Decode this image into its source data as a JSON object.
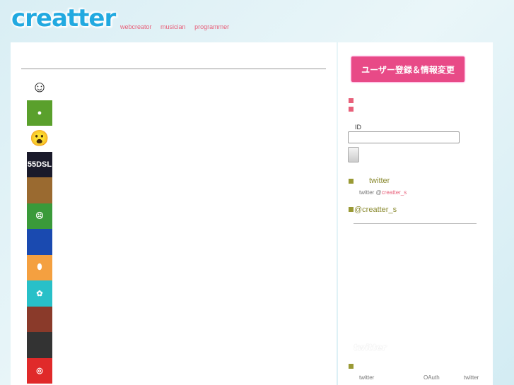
{
  "header": {
    "logo": "creatter",
    "tags": [
      "webcreator",
      "musician",
      "programmer"
    ]
  },
  "main": {
    "avatars": [
      {
        "name": "sketch-face",
        "color": "#ffffff",
        "glyph": "☺"
      },
      {
        "name": "bomberman",
        "color": "#5aa02c",
        "glyph": "●"
      },
      {
        "name": "laughing-cartoon",
        "color": "#ffffff",
        "glyph": "😮"
      },
      {
        "name": "55dsl",
        "color": "#1a1a2a",
        "glyph": "55DSL"
      },
      {
        "name": "teddy-bear",
        "color": "#9a6a30",
        "glyph": ""
      },
      {
        "name": "mii-face",
        "color": "#3a9a3a",
        "glyph": "☹"
      },
      {
        "name": "underwater",
        "color": "#1a4ab0",
        "glyph": ""
      },
      {
        "name": "egg",
        "color": "#f4a040",
        "glyph": "⬮"
      },
      {
        "name": "rabbit",
        "color": "#28c0c8",
        "glyph": "✿"
      },
      {
        "name": "stripes",
        "color": "#8a3a2a",
        "glyph": ""
      },
      {
        "name": "girl-photo",
        "color": "#333333",
        "glyph": ""
      },
      {
        "name": "target-face",
        "color": "#e02a2a",
        "glyph": "◎"
      }
    ]
  },
  "sidebar": {
    "register_button": "ユーザー登録＆情報変更",
    "id_label": "ID",
    "twitter_heading": "twitter",
    "twitter_line_prefix": "twitter @",
    "twitter_handle": "creatter_s",
    "handle_heading": "@creatter_s",
    "twitter_widget_logo": "twitter",
    "footer_words": [
      "twitter",
      "OAuth",
      "twitter"
    ]
  },
  "colors": {
    "accent": "#e84a87",
    "olive": "#9a9a35",
    "link": "#e8607a"
  }
}
